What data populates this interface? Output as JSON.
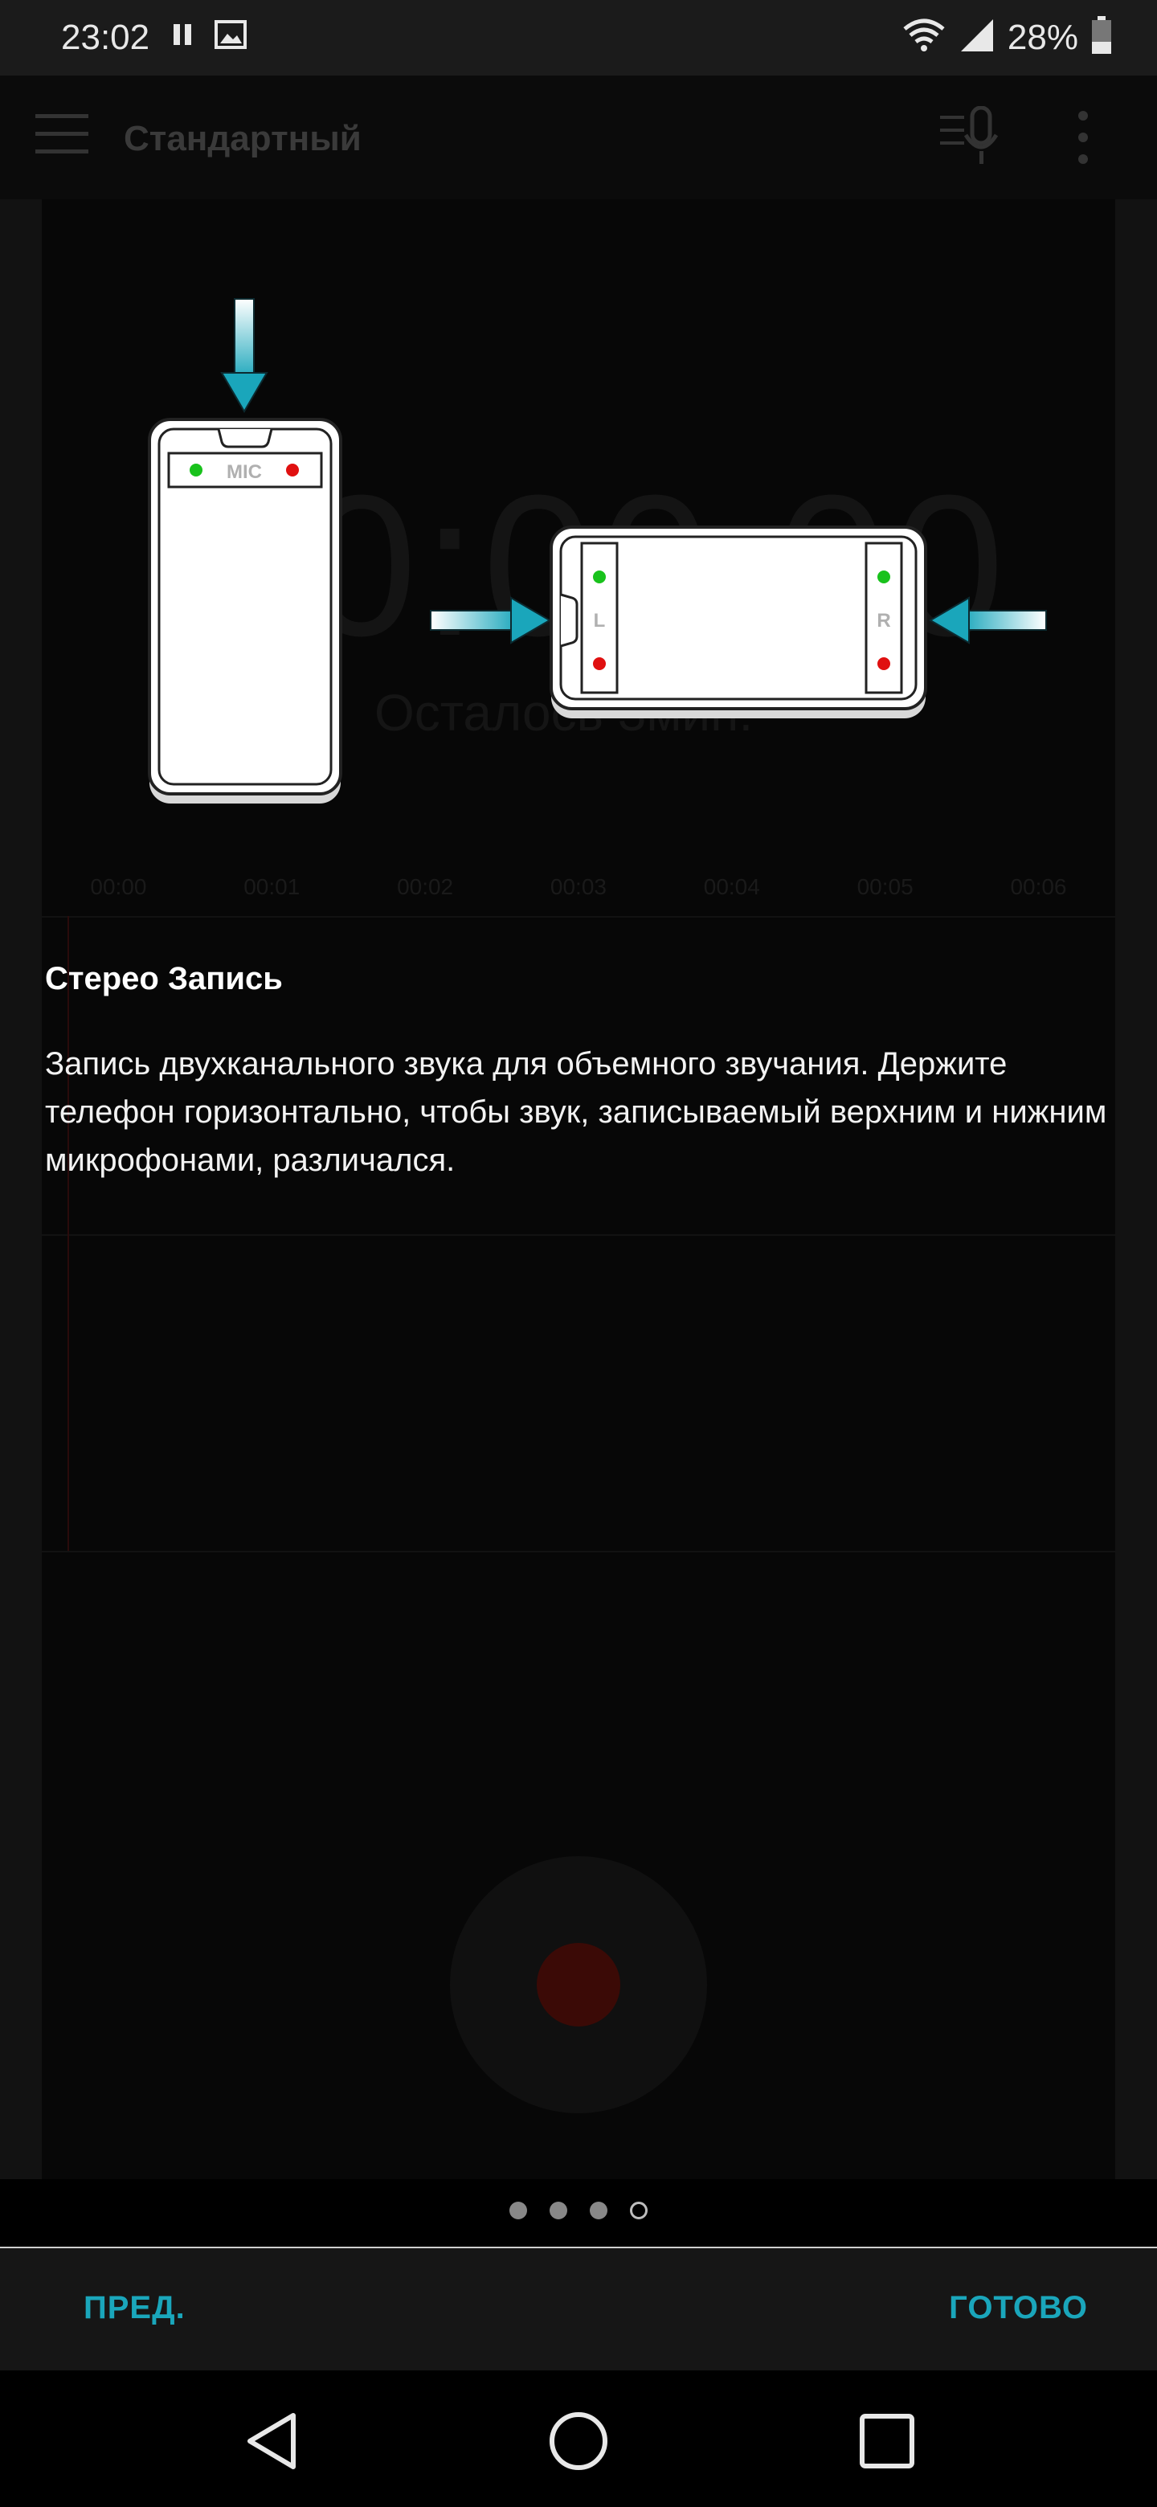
{
  "status_bar": {
    "time": "23:02",
    "battery": "28%",
    "icons": [
      "pause-icon",
      "image-icon",
      "wifi-icon",
      "signal-icon",
      "battery-icon"
    ]
  },
  "app_bar": {
    "title": "Стандартный",
    "icons": [
      "menu-icon",
      "mic-settings-icon",
      "more-icon"
    ]
  },
  "background": {
    "timer": "0:00:00",
    "remaining": "Осталось 3мин.",
    "timeline": [
      "00:00",
      "00:01",
      "00:02",
      "00:03",
      "00:04",
      "00:05",
      "00:06"
    ]
  },
  "illustration": {
    "mic_label": "MIC",
    "left_label": "L",
    "right_label": "R"
  },
  "info": {
    "title": "Стерео Запись",
    "description": "Запись двухканального звука для объемного звучания. Держите телефон горизонтально, чтобы звук, записываемый верхним и нижним микрофонами, различался."
  },
  "pager": {
    "total": 4,
    "current": 4
  },
  "footer": {
    "prev_label": "ПРЕД.",
    "done_label": "ГОТОВО"
  },
  "colors": {
    "accent": "#1aa6bb",
    "mic_green": "#19c21c",
    "mic_red": "#e01010"
  }
}
